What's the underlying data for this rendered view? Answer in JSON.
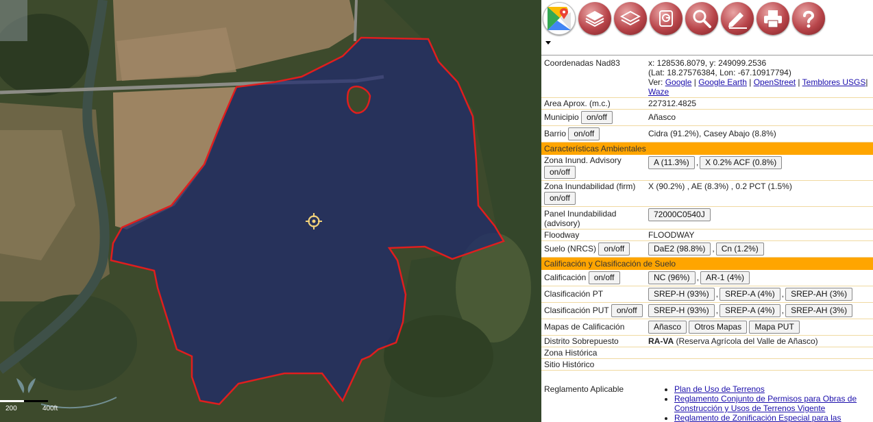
{
  "map": {
    "scale_label_1": "200",
    "scale_label_2": "400ft",
    "colors": {
      "parcel_fill": "#1f2a6e",
      "parcel_border": "#e01e1e",
      "crosshair": "#f2d27a"
    }
  },
  "toolbar": {
    "tools": [
      "google-maps-icon",
      "layers-icon",
      "basemap-layers-icon",
      "gps-icon",
      "search-icon",
      "draw-edit-icon",
      "print-icon",
      "help-icon"
    ]
  },
  "info": {
    "coords": {
      "label": "Coordenadas Nad83",
      "xy": "x: 128536.8079, y: 249099.2536",
      "latlon": "(Lat: 18.27576384, Lon: -67.10917794)",
      "ver": "Ver:",
      "links": [
        "Google",
        "Google Earth",
        "OpenStreet",
        "Temblores USGS",
        "Waze"
      ]
    },
    "area": {
      "label": "Area Aprox. (m.c.)",
      "value": "227312.4825"
    },
    "municipio": {
      "label": "Municipio",
      "toggle": "on/off",
      "value": "Añasco"
    },
    "barrio": {
      "label": "Barrio",
      "toggle": "on/off",
      "value": "Cidra (91.2%), Casey Abajo (8.8%)"
    },
    "section_env": "Características Ambientales",
    "zona_advisory": {
      "label": "Zona Inund. Advisory",
      "toggle": "on/off",
      "chips": [
        "A (11.3%)",
        "X 0.2% ACF (0.8%)"
      ]
    },
    "zona_firm": {
      "label": "Zona Inundabilidad (firm)",
      "toggle": "on/off",
      "value": "X (90.2%) , AE (8.3%) , 0.2 PCT (1.5%)"
    },
    "panel": {
      "label": "Panel Inundabilidad (advisory)",
      "chip": "72000C0540J"
    },
    "floodway": {
      "label": "Floodway",
      "value": "FLOODWAY"
    },
    "suelo": {
      "label": "Suelo (NRCS)",
      "toggle": "on/off",
      "chips": [
        "DaE2 (98.8%)",
        "Cn (1.2%)"
      ]
    },
    "section_calif": "Calificación y Clasificación de Suelo",
    "calificacion": {
      "label": "Calificación",
      "toggle": "on/off",
      "chips": [
        "NC (96%)",
        "AR-1 (4%)"
      ]
    },
    "clas_pt": {
      "label": "Clasificación PT",
      "chips": [
        "SREP-H (93%)",
        "SREP-A (4%)",
        "SREP-AH (3%)"
      ]
    },
    "clas_put": {
      "label": "Clasificación PUT",
      "toggle": "on/off",
      "chips": [
        "SREP-H (93%)",
        "SREP-A (4%)",
        "SREP-AH (3%)"
      ]
    },
    "mapas": {
      "label": "Mapas de Calificación",
      "chips": [
        "Añasco",
        "Otros Mapas",
        "Mapa PUT"
      ]
    },
    "distrito": {
      "label": "Distrito Sobrepuesto",
      "code": "RA-VA",
      "desc": "(Reserva Agrícola del Valle de Añasco)"
    },
    "zona_historica": {
      "label": "Zona Histórica"
    },
    "sitio_historico": {
      "label": "Sitio Histórico"
    },
    "reglamento": {
      "label": "Reglamento Aplicable",
      "links": [
        "Plan de Uso de Terrenos",
        "Reglamento Conjunto de Permisos para Obras de Construcción y Usos de Terrenos Vigente",
        "Reglamento de Zonificación Especial para las"
      ]
    }
  }
}
